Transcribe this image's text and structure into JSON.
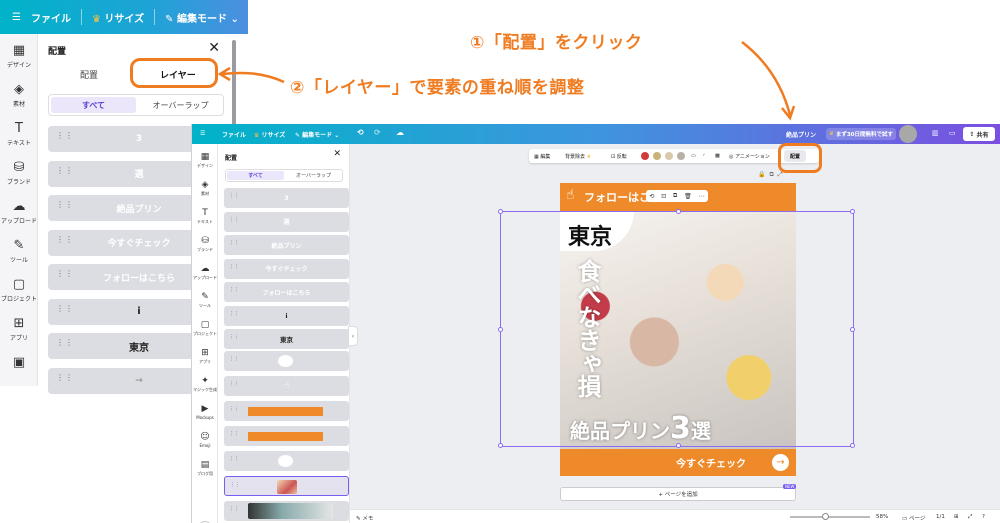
{
  "annotations": {
    "step1": "①「配置」をクリック",
    "step2": "②「レイヤー」で要素の重ね順を調整"
  },
  "zoom": {
    "topbar": {
      "file": "ファイル",
      "resize": "リサイズ",
      "edit_mode": "編集モード"
    },
    "rail": [
      {
        "icon": "▦",
        "label": "デザイン"
      },
      {
        "icon": "◈",
        "label": "素材"
      },
      {
        "icon": "T",
        "label": "テキスト"
      },
      {
        "icon": "⛁",
        "label": "ブランド"
      },
      {
        "icon": "☁",
        "label": "アップロード"
      },
      {
        "icon": "✎",
        "label": "ツール"
      },
      {
        "icon": "▢",
        "label": "プロジェクト"
      },
      {
        "icon": "⊞",
        "label": "アプリ"
      },
      {
        "icon": "▣",
        "label": ""
      }
    ],
    "panel": {
      "title": "配置",
      "close": "✕",
      "tab_arrange": "配置",
      "tab_layer": "レイヤー",
      "seg_all": "すべて",
      "seg_overlap": "オーバーラップ",
      "layers": [
        "3",
        "選",
        "絶品プリン",
        "今すぐチェック",
        "フォローはこちら",
        "i",
        "東京",
        "→"
      ]
    }
  },
  "win": {
    "topbar": {
      "menu": "☰",
      "file": "ファイル",
      "resize": "リサイズ",
      "edit_mode": "編集モード",
      "undo": "⟲",
      "redo": "⟳",
      "cloud": "☁",
      "doc_title": "絶品プリン",
      "trial": "まず30日間無料で試す",
      "share": "共有"
    },
    "rail": [
      {
        "icon": "▦",
        "label": "デザイン"
      },
      {
        "icon": "◈",
        "label": "素材"
      },
      {
        "icon": "T",
        "label": "テキスト"
      },
      {
        "icon": "⛁",
        "label": "ブランド"
      },
      {
        "icon": "☁",
        "label": "アップロード"
      },
      {
        "icon": "✎",
        "label": "ツール"
      },
      {
        "icon": "▢",
        "label": "プロジェクト"
      },
      {
        "icon": "⊞",
        "label": "アプリ"
      },
      {
        "icon": "✦",
        "label": "マジック生成"
      },
      {
        "icon": "▶",
        "label": "Mockups"
      },
      {
        "icon": "☺",
        "label": "Emoji"
      },
      {
        "icon": "▤",
        "label": "ブログ用"
      }
    ],
    "panel": {
      "title": "配置",
      "close": "✕",
      "seg_all": "すべて",
      "seg_overlap": "オーバーラップ",
      "layers": [
        "3",
        "選",
        "絶品プリン",
        "今すぐチェック",
        "フォローはこちら",
        "i",
        "東京"
      ]
    },
    "context_bar": {
      "edit": "編集",
      "remove_bg": "背景除去",
      "flip": "反転",
      "animate": "アニメーション",
      "arrange": "配置",
      "swatches": [
        "#d23b3b",
        "#c9b27a",
        "#d9c9a9",
        "#b7b0a7"
      ]
    },
    "design": {
      "follow": "フォローはこちら",
      "tokyo": "東京",
      "vertical": "食べなきゃ損",
      "title_a": "絶品プリン",
      "title_num": "3",
      "title_b": "選",
      "cta": "今すぐチェック"
    },
    "add_page": "+ ページを追加",
    "new_badge": "NEW",
    "footer": {
      "memo": "メモ",
      "zoom": "58%",
      "pages": "ページ",
      "page_count": "1/1"
    }
  },
  "colors": {
    "accent": "#f07c22",
    "selection": "#8b6cf2",
    "brand_orange": "#ef8a2b"
  }
}
